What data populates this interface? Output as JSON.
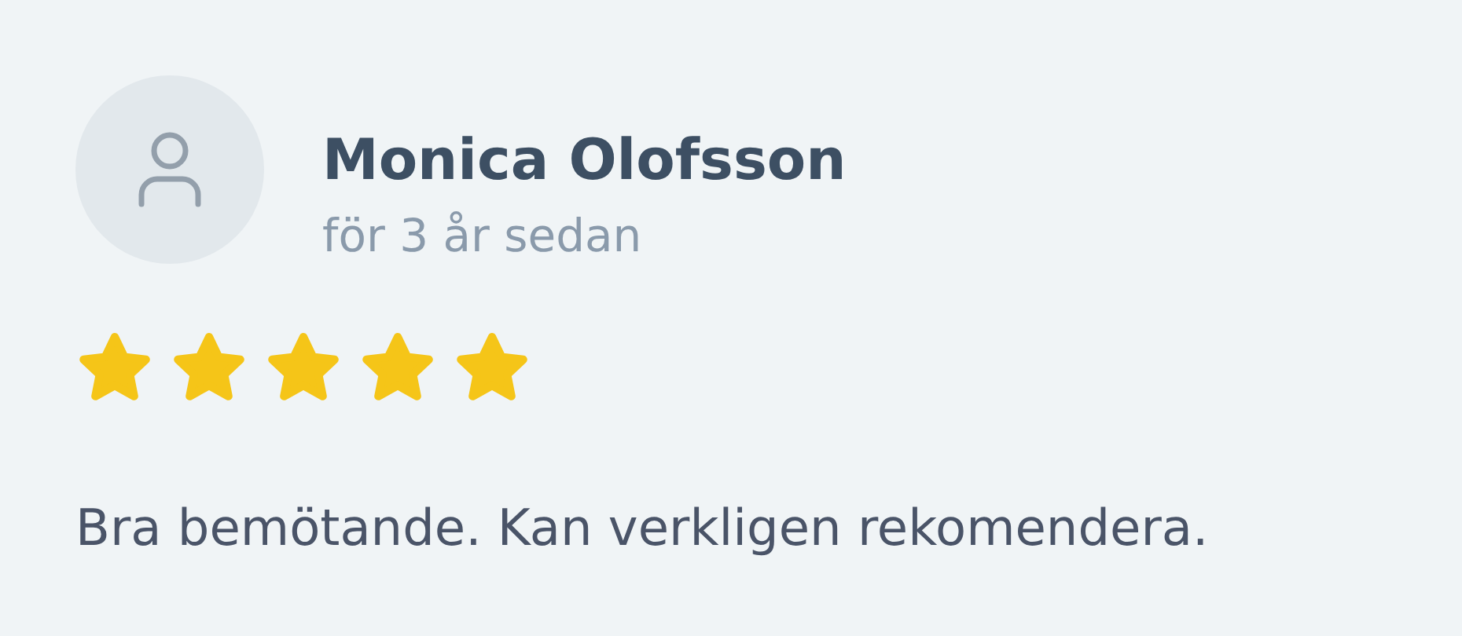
{
  "review": {
    "author": "Monica Olofsson",
    "time": "för 3 år sedan",
    "stars": 5,
    "text": "Bra bemötande. Kan verkligen rekomendera."
  }
}
